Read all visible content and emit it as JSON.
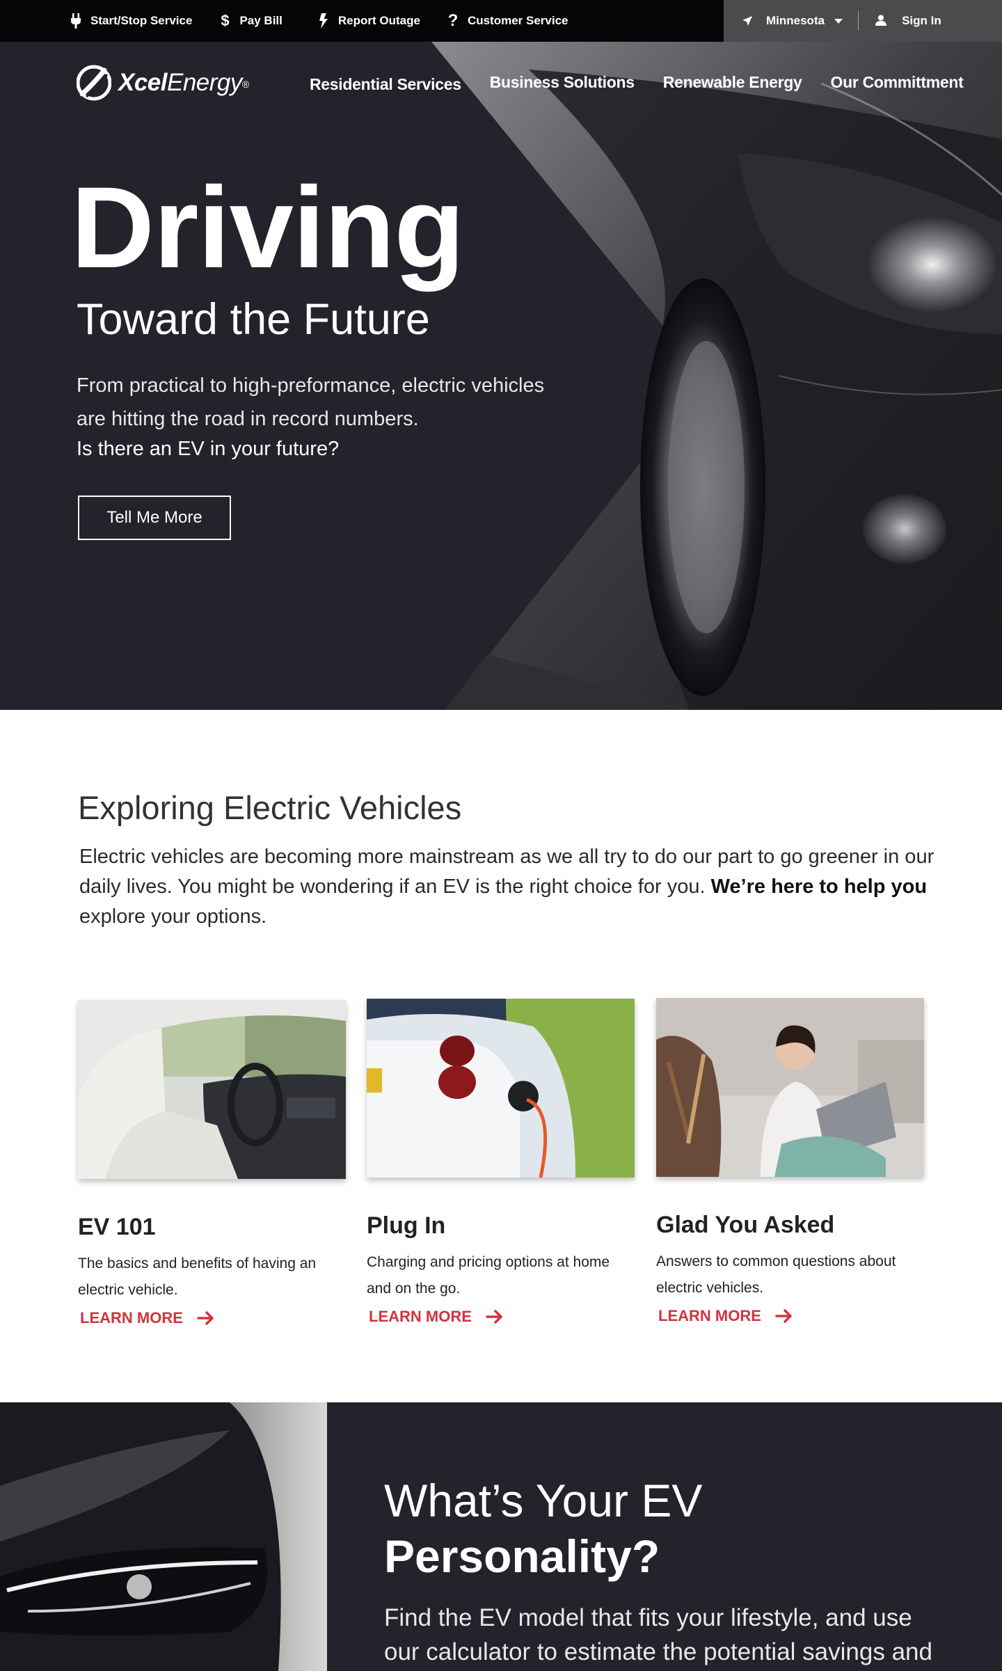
{
  "utility_bar": {
    "links": [
      {
        "label": "Start/Stop Service",
        "icon": "plug-icon"
      },
      {
        "label": "Pay Bill",
        "icon": "dollar-icon"
      },
      {
        "label": "Report Outage",
        "icon": "lightning-icon"
      },
      {
        "label": "Customer Service",
        "icon": "question-icon"
      }
    ],
    "location": {
      "label": "Minnesota",
      "icon": "location-arrow-icon"
    },
    "signin": {
      "label": "Sign In",
      "icon": "user-icon"
    }
  },
  "header": {
    "logo_bold": "Xcel",
    "logo_regular": "Energy",
    "logo_mark": "®",
    "nav": [
      "Residential Services",
      "Business Solutions",
      "Renewable Energy",
      "Our Committment"
    ]
  },
  "hero": {
    "title": "Driving",
    "subtitle": "Toward the Future",
    "description": "From practical to high-preformance, electric vehicles are hitting the road in record numbers.",
    "question": "Is there an EV in your future?",
    "button": "Tell Me More"
  },
  "explore": {
    "title": "Exploring Electric Vehicles",
    "body_start": "Electric vehicles are becoming more mainstream as we all try to do our part to go greener in our daily lives. You might be wondering if an EV is the right choice for you. ",
    "body_bold": "We’re here to help you",
    "body_end": " explore your options."
  },
  "cards": [
    {
      "title": "EV 101",
      "text": "The basics and benefits of having an electric vehicle.",
      "link": "LEARN MORE"
    },
    {
      "title": "Plug In",
      "text": "Charging and pricing options at home and on the go.",
      "link": "LEARN MORE"
    },
    {
      "title": "Glad You Asked",
      "text": "Answers to common questions about electric vehicles.",
      "link": "LEARN MORE"
    }
  ],
  "personality": {
    "title_light": "What’s Your EV",
    "title_bold": "Personality?",
    "body": "Find the EV model that fits your lifestyle, and use our calculator to estimate the potential savings and"
  },
  "colors": {
    "dark": "#22232b",
    "utility_bar": "#050607",
    "utility_right": "#4a4b4d",
    "accent_red": "#d1343e"
  }
}
